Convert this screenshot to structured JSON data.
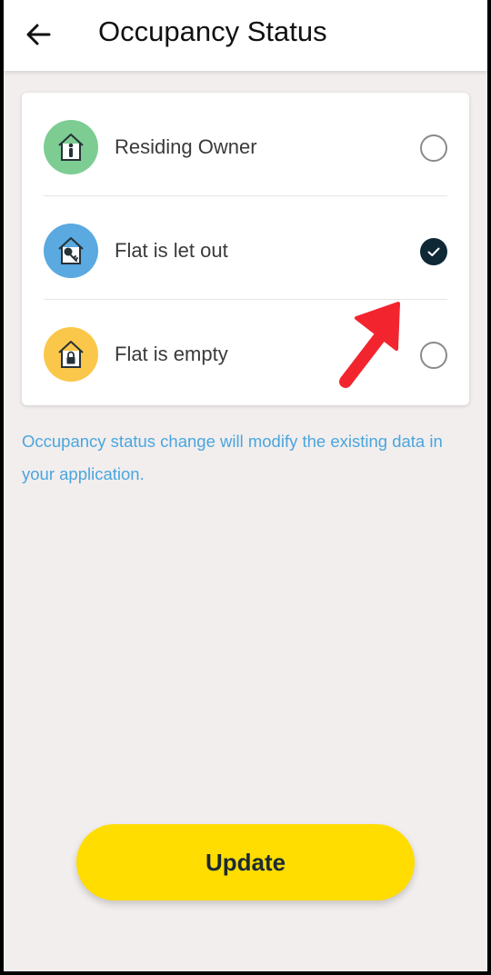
{
  "header": {
    "title": "Occupancy Status",
    "back_icon": "arrow-left-icon"
  },
  "options": [
    {
      "label": "Residing Owner",
      "icon": "house-person-icon",
      "icon_bg": "#7dcd93",
      "selected": false
    },
    {
      "label": "Flat is let out",
      "icon": "house-key-icon",
      "icon_bg": "#5aa9e0",
      "selected": true
    },
    {
      "label": "Flat is empty",
      "icon": "house-lock-icon",
      "icon_bg": "#fbc74a",
      "selected": false
    }
  ],
  "note": "Occupancy status change will modify the existing data in your application.",
  "update_label": "Update",
  "colors": {
    "accent": "#ffdd00",
    "note_text": "#4aa6dd",
    "selected_radio": "#0e2836",
    "annotation_arrow": "#f2252e"
  }
}
